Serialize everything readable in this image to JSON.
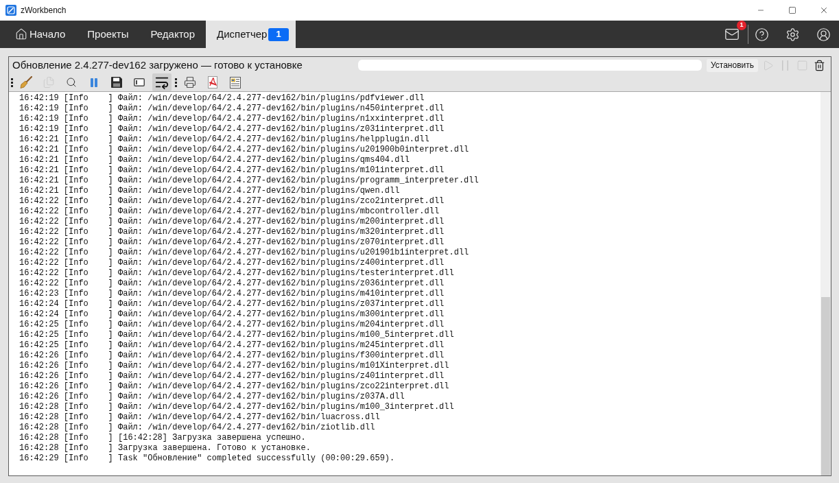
{
  "window": {
    "title": "zWorkbench"
  },
  "nav": {
    "tabs": [
      {
        "label": "Начало",
        "kind": "home",
        "selected": false
      },
      {
        "label": "Проекты",
        "kind": "plain",
        "selected": false
      },
      {
        "label": "Редактор",
        "kind": "plain",
        "selected": false
      },
      {
        "label": "Диспетчер",
        "kind": "plain",
        "selected": true,
        "badge": "1"
      }
    ],
    "messages": {
      "badge": "1"
    }
  },
  "task": {
    "title": "Обновление 2.4.277-dev162 загружено — готово к установке",
    "install_button": "Установить",
    "controls": [
      {
        "kind": "start",
        "disabled": true
      },
      {
        "kind": "pause",
        "disabled": true
      },
      {
        "kind": "stop",
        "disabled": true
      },
      {
        "kind": "delete",
        "disabled": false
      }
    ]
  },
  "toolbar": {
    "groups": [
      [
        {
          "kind": "clear",
          "disabled": false,
          "on": false
        },
        {
          "kind": "copy",
          "disabled": true,
          "on": false
        },
        {
          "kind": "find",
          "disabled": false,
          "on": false
        },
        {
          "kind": "pause",
          "disabled": false,
          "on": false
        },
        {
          "kind": "save",
          "disabled": false,
          "on": false
        },
        {
          "kind": "panel",
          "disabled": false,
          "on": false
        },
        {
          "kind": "wrap",
          "disabled": false,
          "on": true
        }
      ],
      [
        {
          "kind": "print",
          "disabled": false,
          "on": false
        },
        {
          "kind": "pdf",
          "disabled": false,
          "on": false
        },
        {
          "kind": "report",
          "disabled": false,
          "on": false
        }
      ]
    ]
  },
  "log": {
    "lines": [
      {
        "time": "16:42:19",
        "level": "[Info    ]",
        "message": "Файл: /win/develop/64/2.4.277-dev162/bin/plugins/pdfviewer.dll"
      },
      {
        "time": "16:42:19",
        "level": "[Info    ]",
        "message": "Файл: /win/develop/64/2.4.277-dev162/bin/plugins/n450interpret.dll"
      },
      {
        "time": "16:42:19",
        "level": "[Info    ]",
        "message": "Файл: /win/develop/64/2.4.277-dev162/bin/plugins/n1xxinterpret.dll"
      },
      {
        "time": "16:42:19",
        "level": "[Info    ]",
        "message": "Файл: /win/develop/64/2.4.277-dev162/bin/plugins/z031interpret.dll"
      },
      {
        "time": "16:42:21",
        "level": "[Info    ]",
        "message": "Файл: /win/develop/64/2.4.277-dev162/bin/plugins/helpplugin.dll"
      },
      {
        "time": "16:42:21",
        "level": "[Info    ]",
        "message": "Файл: /win/develop/64/2.4.277-dev162/bin/plugins/u201900b0interpret.dll"
      },
      {
        "time": "16:42:21",
        "level": "[Info    ]",
        "message": "Файл: /win/develop/64/2.4.277-dev162/bin/plugins/qms404.dll"
      },
      {
        "time": "16:42:21",
        "level": "[Info    ]",
        "message": "Файл: /win/develop/64/2.4.277-dev162/bin/plugins/m101interpret.dll"
      },
      {
        "time": "16:42:21",
        "level": "[Info    ]",
        "message": "Файл: /win/develop/64/2.4.277-dev162/bin/plugins/programm_interpreter.dll"
      },
      {
        "time": "16:42:21",
        "level": "[Info    ]",
        "message": "Файл: /win/develop/64/2.4.277-dev162/bin/plugins/qwen.dll"
      },
      {
        "time": "16:42:22",
        "level": "[Info    ]",
        "message": "Файл: /win/develop/64/2.4.277-dev162/bin/plugins/zco2interpret.dll"
      },
      {
        "time": "16:42:22",
        "level": "[Info    ]",
        "message": "Файл: /win/develop/64/2.4.277-dev162/bin/plugins/mbcontroller.dll"
      },
      {
        "time": "16:42:22",
        "level": "[Info    ]",
        "message": "Файл: /win/develop/64/2.4.277-dev162/bin/plugins/m200interpret.dll"
      },
      {
        "time": "16:42:22",
        "level": "[Info    ]",
        "message": "Файл: /win/develop/64/2.4.277-dev162/bin/plugins/m320interpret.dll"
      },
      {
        "time": "16:42:22",
        "level": "[Info    ]",
        "message": "Файл: /win/develop/64/2.4.277-dev162/bin/plugins/z070interpret.dll"
      },
      {
        "time": "16:42:22",
        "level": "[Info    ]",
        "message": "Файл: /win/develop/64/2.4.277-dev162/bin/plugins/u201901b1interpret.dll"
      },
      {
        "time": "16:42:22",
        "level": "[Info    ]",
        "message": "Файл: /win/develop/64/2.4.277-dev162/bin/plugins/z400interpret.dll"
      },
      {
        "time": "16:42:22",
        "level": "[Info    ]",
        "message": "Файл: /win/develop/64/2.4.277-dev162/bin/plugins/testerinterpret.dll"
      },
      {
        "time": "16:42:22",
        "level": "[Info    ]",
        "message": "Файл: /win/develop/64/2.4.277-dev162/bin/plugins/z036interpret.dll"
      },
      {
        "time": "16:42:23",
        "level": "[Info    ]",
        "message": "Файл: /win/develop/64/2.4.277-dev162/bin/plugins/m410interpret.dll"
      },
      {
        "time": "16:42:24",
        "level": "[Info    ]",
        "message": "Файл: /win/develop/64/2.4.277-dev162/bin/plugins/z037interpret.dll"
      },
      {
        "time": "16:42:24",
        "level": "[Info    ]",
        "message": "Файл: /win/develop/64/2.4.277-dev162/bin/plugins/m300interpret.dll"
      },
      {
        "time": "16:42:25",
        "level": "[Info    ]",
        "message": "Файл: /win/develop/64/2.4.277-dev162/bin/plugins/m204interpret.dll"
      },
      {
        "time": "16:42:25",
        "level": "[Info    ]",
        "message": "Файл: /win/develop/64/2.4.277-dev162/bin/plugins/m100_5interpret.dll"
      },
      {
        "time": "16:42:25",
        "level": "[Info    ]",
        "message": "Файл: /win/develop/64/2.4.277-dev162/bin/plugins/m245interpret.dll"
      },
      {
        "time": "16:42:26",
        "level": "[Info    ]",
        "message": "Файл: /win/develop/64/2.4.277-dev162/bin/plugins/f300interpret.dll"
      },
      {
        "time": "16:42:26",
        "level": "[Info    ]",
        "message": "Файл: /win/develop/64/2.4.277-dev162/bin/plugins/m101Xinterpret.dll"
      },
      {
        "time": "16:42:26",
        "level": "[Info    ]",
        "message": "Файл: /win/develop/64/2.4.277-dev162/bin/plugins/z401interpret.dll"
      },
      {
        "time": "16:42:26",
        "level": "[Info    ]",
        "message": "Файл: /win/develop/64/2.4.277-dev162/bin/plugins/zco22interpret.dll"
      },
      {
        "time": "16:42:26",
        "level": "[Info    ]",
        "message": "Файл: /win/develop/64/2.4.277-dev162/bin/plugins/z037A.dll"
      },
      {
        "time": "16:42:28",
        "level": "[Info    ]",
        "message": "Файл: /win/develop/64/2.4.277-dev162/bin/plugins/m100_3interpret.dll"
      },
      {
        "time": "16:42:28",
        "level": "[Info    ]",
        "message": "Файл: /win/develop/64/2.4.277-dev162/bin/luacross.dll"
      },
      {
        "time": "16:42:28",
        "level": "[Info    ]",
        "message": "Файл: /win/develop/64/2.4.277-dev162/bin/ziotlib.dll"
      },
      {
        "time": "16:42:28",
        "level": "[Info    ]",
        "message": "[16:42:28] Загрузка завершена успешно."
      },
      {
        "time": "16:42:28",
        "level": "[Info    ]",
        "message": "Загрузка завершена. Готово к установке."
      },
      {
        "time": "16:42:29",
        "level": "[Info    ]",
        "message": "Task \"Обновление\" completed successfully (00:00:29.659)."
      }
    ]
  }
}
